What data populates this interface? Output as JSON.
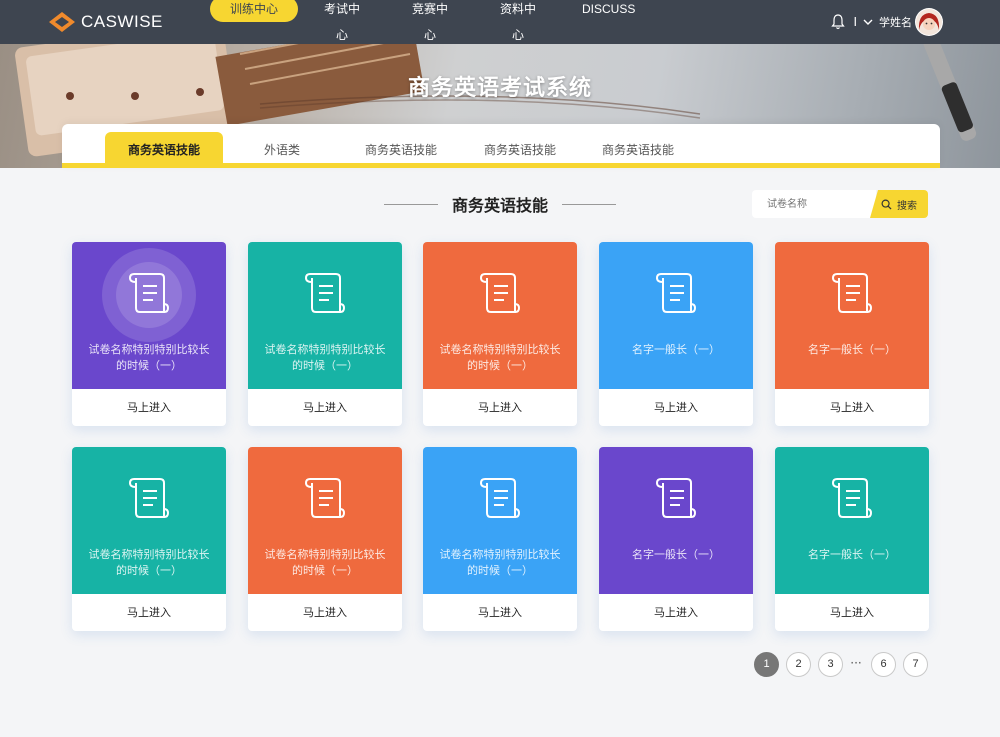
{
  "header": {
    "logo_text": "CASWISE",
    "nav": [
      "训练中心",
      "考试中心",
      "竞赛中心",
      "资料中心",
      "DISCUSS"
    ],
    "active_nav": "训练中心",
    "separator": "I",
    "user_name": "学姓名",
    "accent_color": "#f7d631",
    "bar_color": "#3e4550"
  },
  "banner": {
    "title": "商务英语考试系统"
  },
  "tabs": [
    "商务英语技能",
    "外语类",
    "商务英语技能",
    "商务英语技能",
    "商务英语技能"
  ],
  "active_tab": 0,
  "section": {
    "title": "商务英语技能"
  },
  "search": {
    "placeholder": "试卷名称",
    "button": "搜索"
  },
  "cards": [
    {
      "name": "试卷名称特别特别比较长的时候（一）",
      "button": "马上进入",
      "color": "#6a47cc",
      "icon": "scroll-icon"
    },
    {
      "name": "试卷名称特别特别比较长的时候（一）",
      "button": "马上进入",
      "color": "#17b3a5",
      "icon": "scroll-icon"
    },
    {
      "name": "试卷名称特别特别比较长的时候（一）",
      "button": "马上进入",
      "color": "#ef6a3e",
      "icon": "scroll-icon"
    },
    {
      "name": "名字一般长（一）",
      "button": "马上进入",
      "color": "#3aa3f6",
      "icon": "scroll-icon"
    },
    {
      "name": "名字一般长（一）",
      "button": "马上进入",
      "color": "#ef6a3e",
      "icon": "scroll-icon"
    },
    {
      "name": "试卷名称特别特别比较长的时候（一）",
      "button": "马上进入",
      "color": "#17b3a5",
      "icon": "scroll-icon"
    },
    {
      "name": "试卷名称特别特别比较长的时候（一）",
      "button": "马上进入",
      "color": "#ef6a3e",
      "icon": "scroll-icon"
    },
    {
      "name": "试卷名称特别特别比较长的时候（一）",
      "button": "马上进入",
      "color": "#3aa3f6",
      "icon": "scroll-icon"
    },
    {
      "name": "名字一般长（一）",
      "button": "马上进入",
      "color": "#6a47cc",
      "icon": "scroll-icon"
    },
    {
      "name": "名字一般长（一）",
      "button": "马上进入",
      "color": "#17b3a5",
      "icon": "scroll-icon"
    }
  ],
  "pagination": {
    "pages": [
      "1",
      "2",
      "3",
      "6",
      "7"
    ],
    "ellipsis": "···",
    "current": "1"
  }
}
